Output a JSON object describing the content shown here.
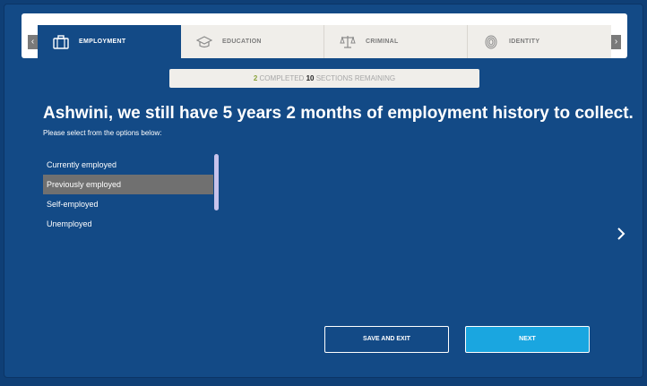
{
  "tabbar": {
    "scroll_left": "‹",
    "scroll_right": "›",
    "tabs": [
      {
        "label": "EMPLOYMENT",
        "icon": "briefcase-icon",
        "active": true
      },
      {
        "label": "EDUCATION",
        "icon": "graduation-cap-icon",
        "active": false
      },
      {
        "label": "CRIMINAL",
        "icon": "scales-icon",
        "active": false
      },
      {
        "label": "IDENTITY",
        "icon": "fingerprint-icon",
        "active": false
      }
    ]
  },
  "progress": {
    "completed": "2",
    "completed_label": "COMPLETED",
    "remaining": "10",
    "remaining_label": "SECTIONS REMAINING"
  },
  "main": {
    "headline": "Ashwini, we still have 5 years 2 months of employment history to collect.",
    "subline": "Please select from the options below:",
    "options": [
      {
        "label": "Currently employed",
        "selected": false
      },
      {
        "label": "Previously employed",
        "selected": true
      },
      {
        "label": "Self-employed",
        "selected": false
      },
      {
        "label": "Unemployed",
        "selected": false
      }
    ]
  },
  "footer": {
    "save_label": "SAVE AND EXIT",
    "next_label": "NEXT"
  },
  "colors": {
    "background": "#134a86",
    "active_tab": "#134a86",
    "next_button": "#1aa6e0",
    "completed_count": "#8aa33b",
    "selected_option": "#707070"
  }
}
